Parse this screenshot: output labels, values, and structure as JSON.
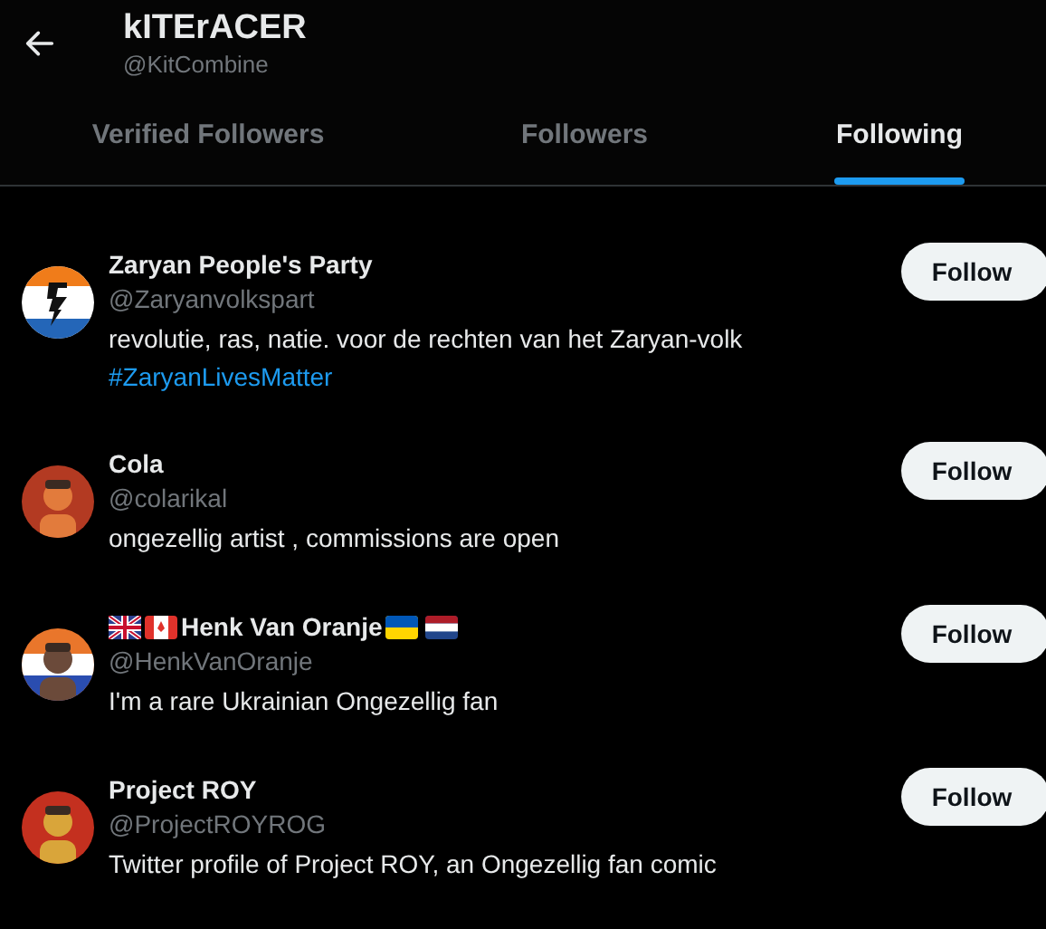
{
  "header": {
    "name": "kITErACER",
    "handle": "@KitCombine"
  },
  "tabs": [
    {
      "label": "Verified Followers",
      "selected": false
    },
    {
      "label": "Followers",
      "selected": false
    },
    {
      "label": "Following",
      "selected": true
    }
  ],
  "accounts": [
    {
      "kind": "logo",
      "name": "Zaryan People's Party",
      "handle": "@Zaryanvolkspart",
      "bio": "revolutie, ras, natie. voor de rechten van het Zaryan-volk",
      "hashtag": "#ZaryanLivesMatter",
      "button": "Follow"
    },
    {
      "kind": "picture",
      "name": "Cola",
      "handle": "@colarikal",
      "bio": "ongezellig artist , commissions are open",
      "button": "Follow"
    },
    {
      "kind": "flagged",
      "name": "Henk Van Oranje",
      "handle": "@HenkVanOranje",
      "bio": "I'm a rare Ukrainian Ongezellig fan",
      "button": "Follow"
    },
    {
      "kind": "picture",
      "name": "Project ROY",
      "handle": "@ProjectROYROG",
      "bio": "Twitter profile of Project ROY, an Ongezellig fan comic",
      "button": "Follow"
    }
  ]
}
